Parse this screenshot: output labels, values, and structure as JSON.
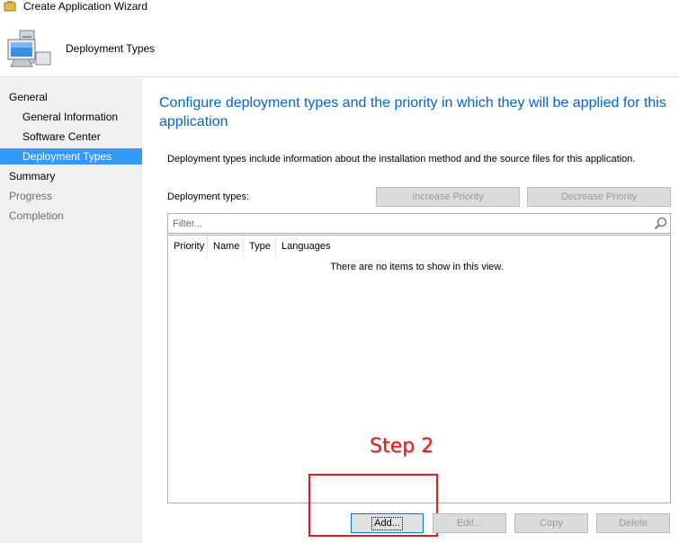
{
  "window": {
    "title": "Create Application Wizard"
  },
  "header": {
    "title": "Deployment Types",
    "icon": "computer-icon"
  },
  "sidebar": {
    "items": [
      {
        "label": "General",
        "level": 0,
        "state": "normal"
      },
      {
        "label": "General Information",
        "level": 1,
        "state": "normal"
      },
      {
        "label": "Software Center",
        "level": 1,
        "state": "normal"
      },
      {
        "label": "Deployment Types",
        "level": 1,
        "state": "active"
      },
      {
        "label": "Summary",
        "level": 0,
        "state": "normal"
      },
      {
        "label": "Progress",
        "level": 0,
        "state": "disabled"
      },
      {
        "label": "Completion",
        "level": 0,
        "state": "disabled"
      }
    ]
  },
  "main": {
    "heading": "Configure deployment types and the priority in which they will be applied for this application",
    "description": "Deployment types include information about the installation method and the source files for this application.",
    "deployment_types_label": "Deployment types:",
    "increase_priority": "Increase Priority",
    "decrease_priority": "Decrease Priority",
    "filter_placeholder": "Filter...",
    "columns": [
      "Priority",
      "Name",
      "Type",
      "Languages"
    ],
    "empty_message": "There are no items to show in this view.",
    "buttons": {
      "add": "Add...",
      "edit": "Edit...",
      "copy": "Copy",
      "delete": "Delete"
    }
  },
  "annotation": {
    "step_label": "Step 2",
    "color": "#e01b24"
  },
  "colors": {
    "accent": "#0066cc",
    "selection": "#3399ff"
  }
}
